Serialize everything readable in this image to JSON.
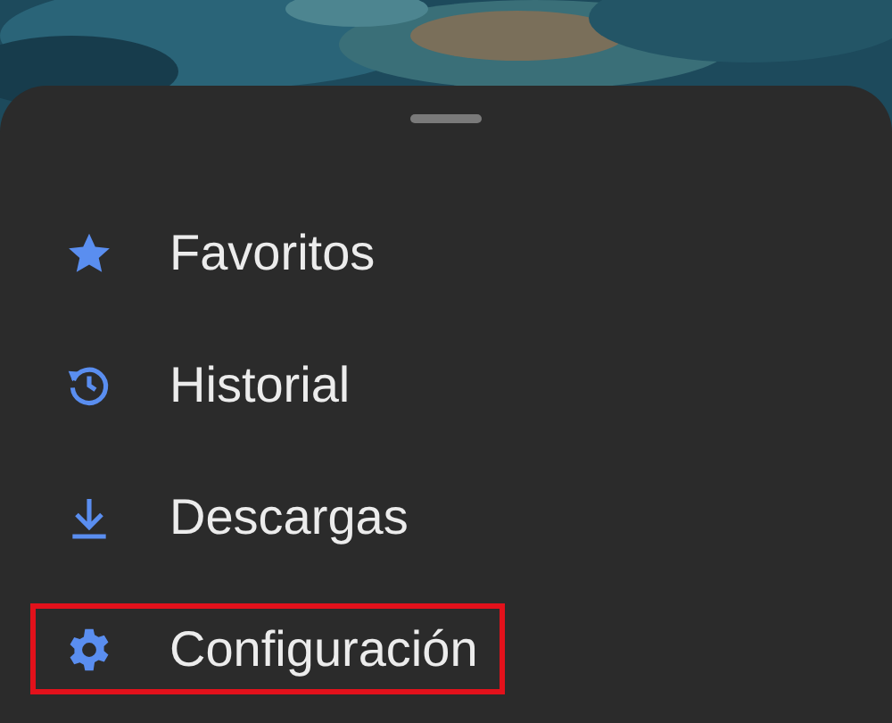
{
  "menu": {
    "items": [
      {
        "kind": "star",
        "label": "Favoritos",
        "highlighted": false
      },
      {
        "kind": "history",
        "label": "Historial",
        "highlighted": false
      },
      {
        "kind": "download",
        "label": "Descargas",
        "highlighted": false
      },
      {
        "kind": "settings",
        "label": "Configuración",
        "highlighted": true
      }
    ]
  }
}
